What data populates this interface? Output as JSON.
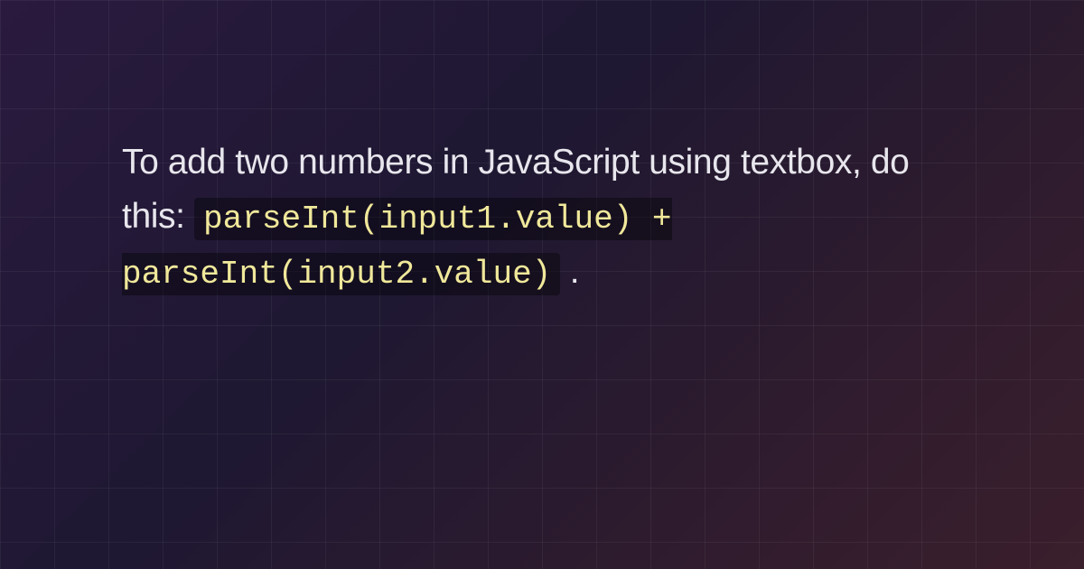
{
  "content": {
    "intro_text": "To add two numbers in JavaScript using textbox, do this: ",
    "code_snippet": "parseInt(input1.value) + parseInt(input2.value)",
    "trailing_text": "."
  }
}
